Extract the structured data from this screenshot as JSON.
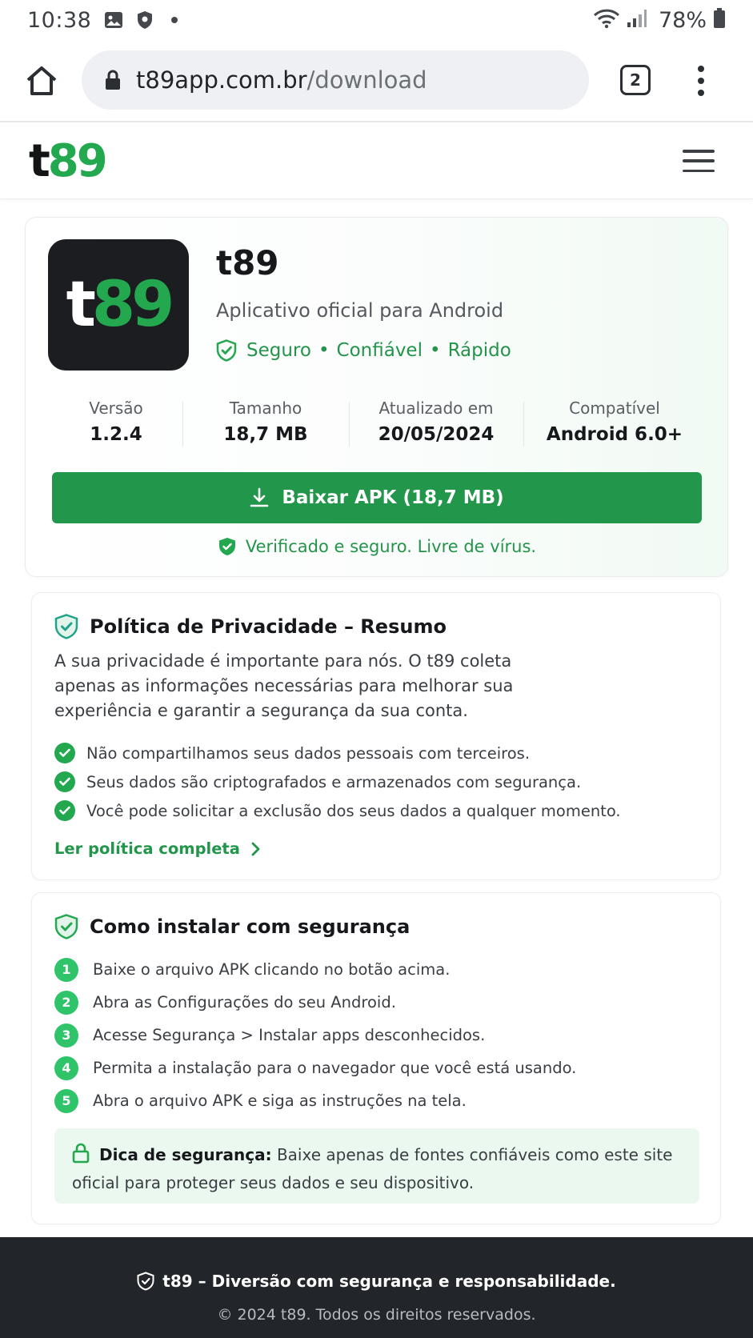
{
  "status_bar": {
    "time": "10:38",
    "battery": "78%",
    "icons": [
      "image-icon",
      "shield-icon",
      "wifi-icon",
      "signal-icon",
      "battery-icon"
    ]
  },
  "browser": {
    "url_domain": "t89app.com.br",
    "url_path": "/download",
    "tab_count": "2"
  },
  "site": {
    "logo_t": "t",
    "logo_n": "89"
  },
  "app": {
    "name": "t89",
    "subtitle": "Aplicativo oficial para Android",
    "badges": [
      "Seguro",
      "Confiável",
      "Rápido"
    ],
    "badge_sep": "•",
    "info": [
      {
        "label": "Versão",
        "value": "1.2.4"
      },
      {
        "label": "Tamanho",
        "value": "18,7 MB"
      },
      {
        "label": "Atualizado em",
        "value": "20/05/2024"
      },
      {
        "label": "Compatível",
        "value": "Android 6.0+"
      }
    ],
    "download_label": "Baixar APK (18,7 MB)",
    "verified": "Verificado e seguro. Livre de vírus."
  },
  "privacy": {
    "title": "Política de Privacidade – Resumo",
    "text": "A sua privacidade é importante para nós. O t89 coleta apenas as informações necessárias para melhorar sua experiência e garantir a segurança da sua conta.",
    "items": [
      "Não compartilhamos seus dados pessoais com terceiros.",
      "Seus dados são criptografados e armazenados com segurança.",
      "Você pode solicitar a exclusão dos seus dados a qualquer momento."
    ],
    "link": "Ler política completa"
  },
  "install": {
    "title": "Como instalar com segurança",
    "steps": [
      {
        "n": "1",
        "text": "Baixe o arquivo APK clicando no botão acima."
      },
      {
        "n": "2",
        "text": "Abra as Configurações do seu Android."
      },
      {
        "n": "3",
        "text": "Acesse Segurança > Instalar apps desconhecidos."
      },
      {
        "n": "4",
        "text": "Permita a instalação para o navegador que você está usando."
      },
      {
        "n": "5",
        "text": "Abra o arquivo APK e siga as instruções na tela."
      }
    ],
    "tip_label": "Dica de segurança:",
    "tip_text": " Baixe apenas de fontes confiáveis como este site oficial para proteger seus dados e seu dispositivo."
  },
  "footer": {
    "tagline": "t89 – Diversão com segurança e responsabilidade.",
    "copyright": "© 2024 t89. Todos os direitos reservados."
  },
  "colors": {
    "brand_green": "#23a84f",
    "button_green": "#22964a",
    "footer_bg": "#222529"
  }
}
